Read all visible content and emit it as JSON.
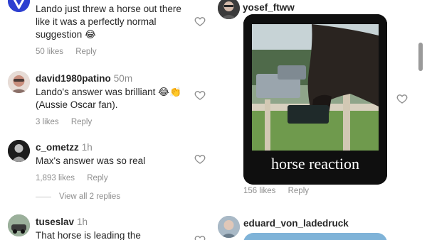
{
  "left_comments": [
    {
      "username": "",
      "time": "",
      "text": "Lando just threw a horse out there like it was a perfectly normal suggestion 😂",
      "likes": "50 likes",
      "reply": "Reply"
    },
    {
      "username": "david1980patino",
      "time": "50m",
      "text": "Lando's answer was brilliant 😂👏 (Aussie Oscar fan).",
      "likes": "3 likes",
      "reply": "Reply"
    },
    {
      "username": "c_ometzz",
      "time": "1h",
      "text": "Max's answer was so real",
      "likes": "1,893 likes",
      "reply": "Reply"
    },
    {
      "username": "tuseslav",
      "time": "1h",
      "text": "That horse is leading the",
      "likes": "",
      "reply": ""
    }
  ],
  "view_replies": "View all 2 replies",
  "right_comments": [
    {
      "username": "yosef_ftww",
      "media_caption": "horse reaction",
      "likes": "156 likes",
      "reply": "Reply"
    },
    {
      "username": "eduard_von_ladedruck"
    }
  ],
  "colors": {
    "text_primary": "#262626",
    "text_secondary": "#8e8e8e",
    "avatar_brand": "#2d3fd0"
  }
}
